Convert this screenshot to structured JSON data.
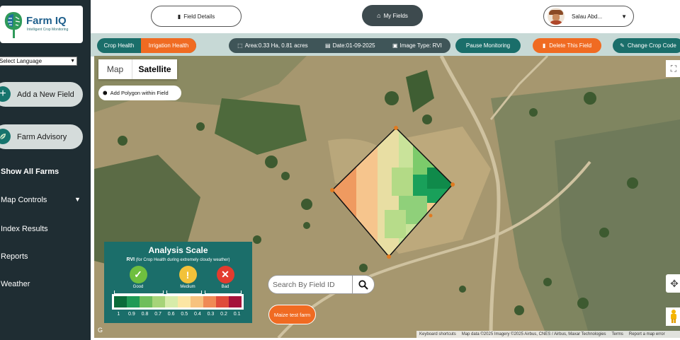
{
  "brand": {
    "name": "Farm IQ",
    "tagline": "Intelligent Crop Monitoring"
  },
  "language_select": {
    "value": "Select Language"
  },
  "sidebar": {
    "add_field": "Add a New Field",
    "advisory": "Farm Advisory",
    "links": {
      "show_all": "Show All Farms",
      "map_controls": "Map Controls",
      "index_results": "Index Results",
      "reports": "Reports",
      "weather": "Weather"
    }
  },
  "header": {
    "field_details": "Field Details",
    "my_fields": "My Fields",
    "user_name": "Salau Abd..."
  },
  "toolbar": {
    "crop_health": "Crop Health",
    "irrigation_health": "Irrigation Health",
    "area": "Area:0.33 Ha, 0.81 acres",
    "date": "Date:01-09-2025",
    "image_type": "Image Type: RVI",
    "pause": "Pause Monitoring",
    "delete": "Delete This Field",
    "change_crop": "Change Crop Code"
  },
  "map": {
    "type_map": "Map",
    "type_satellite": "Satellite",
    "add_polygon": "Add Polygon within Field",
    "search_placeholder": "Search By Field ID",
    "field_chip": "Maize test farm",
    "attribution": {
      "shortcuts": "Keyboard shortcuts",
      "data": "Map data ©2025 Imagery ©2025 Airbus, CNES / Airbus, Maxar Technologies",
      "terms": "Terms",
      "report": "Report a map error"
    }
  },
  "analysis_scale": {
    "title": "Analysis Scale",
    "index": "RVI",
    "note": "(for Crop Health during extremely cloudy weather)",
    "good": "Good",
    "medium": "Medium",
    "bad": "Bad",
    "ticks": [
      "1",
      "0.9",
      "0.8",
      "0.7",
      "0.6",
      "0.5",
      "0.4",
      "0.3",
      "0.2",
      "0.1"
    ],
    "colors": [
      "#0b6b3a",
      "#1f9a55",
      "#6fbe5c",
      "#a6d479",
      "#d7ecaa",
      "#fbe6a4",
      "#f7c27e",
      "#f08a55",
      "#df4b3a",
      "#a5123a"
    ]
  },
  "icons": {
    "document": "document-icon",
    "home": "home-icon",
    "plus": "plus-icon",
    "leaf": "leaf-icon",
    "search": "search-icon",
    "fullscreen": "fullscreen-icon",
    "pegman": "pegman-icon"
  }
}
